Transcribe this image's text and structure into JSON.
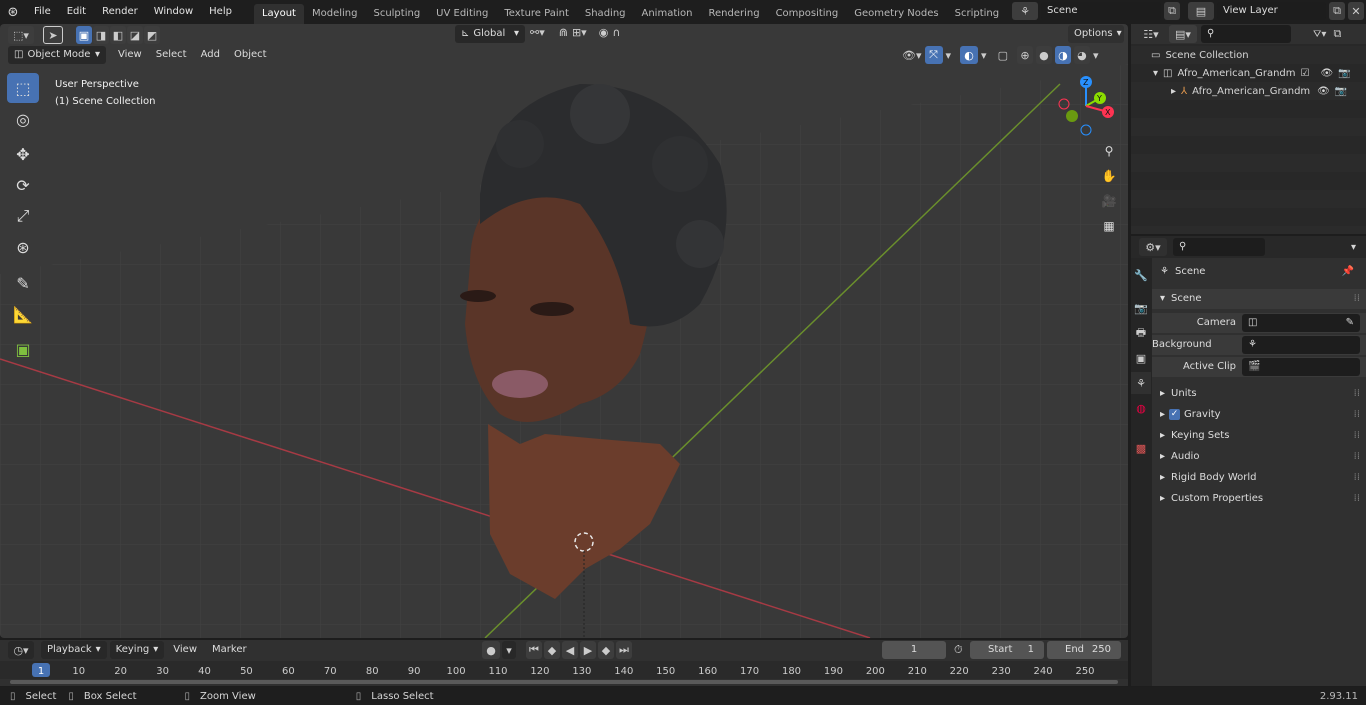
{
  "topbar": {
    "menus": [
      "File",
      "Edit",
      "Render",
      "Window",
      "Help"
    ],
    "workspaces": [
      "Layout",
      "Modeling",
      "Sculpting",
      "UV Editing",
      "Texture Paint",
      "Shading",
      "Animation",
      "Rendering",
      "Compositing",
      "Geometry Nodes",
      "Scripting"
    ],
    "active_workspace": "Layout",
    "add_tab": "+",
    "scene": "Scene",
    "view_layer": "View Layer"
  },
  "viewport": {
    "transform_orientation": "Global",
    "options_label": "Options",
    "mode": "Object Mode",
    "menus": [
      "View",
      "Select",
      "Add",
      "Object"
    ],
    "overlay_title": "User Perspective",
    "overlay_subtitle": "(1) Scene Collection",
    "gizmo": {
      "z": "Z",
      "y": "Y",
      "x": "X"
    }
  },
  "outliner": {
    "search_placeholder": "",
    "root": "Scene Collection",
    "items": [
      {
        "label": "Afro_American_Grandma_Hea"
      },
      {
        "label": "Afro_American_Grandma"
      }
    ]
  },
  "properties": {
    "context": "Scene",
    "panel_title": "Scene",
    "fields": [
      {
        "label": "Camera",
        "value": ""
      },
      {
        "label": "Background Scene",
        "value": ""
      },
      {
        "label": "Active Clip",
        "value": ""
      }
    ],
    "sections": [
      "Units",
      "Gravity",
      "Keying Sets",
      "Audio",
      "Rigid Body World",
      "Custom Properties"
    ],
    "gravity_checked": true
  },
  "timeline": {
    "menus": [
      "Playback",
      "Keying",
      "View",
      "Marker"
    ],
    "current_frame": "1",
    "start_label": "Start",
    "start": "1",
    "end_label": "End",
    "end": "250",
    "ticks": [
      "1",
      "10",
      "20",
      "30",
      "40",
      "50",
      "60",
      "70",
      "80",
      "90",
      "100",
      "110",
      "120",
      "130",
      "140",
      "150",
      "160",
      "170",
      "180",
      "190",
      "200",
      "210",
      "220",
      "230",
      "240",
      "250"
    ]
  },
  "statusbar": {
    "items": [
      "Select",
      "Box Select",
      "Zoom View",
      "Lasso Select"
    ],
    "version": "2.93.11"
  },
  "colors": {
    "accent": "#4772b3",
    "x_axis": "#ff3352",
    "y_axis": "#8bdc00",
    "z_axis": "#2890ff"
  }
}
